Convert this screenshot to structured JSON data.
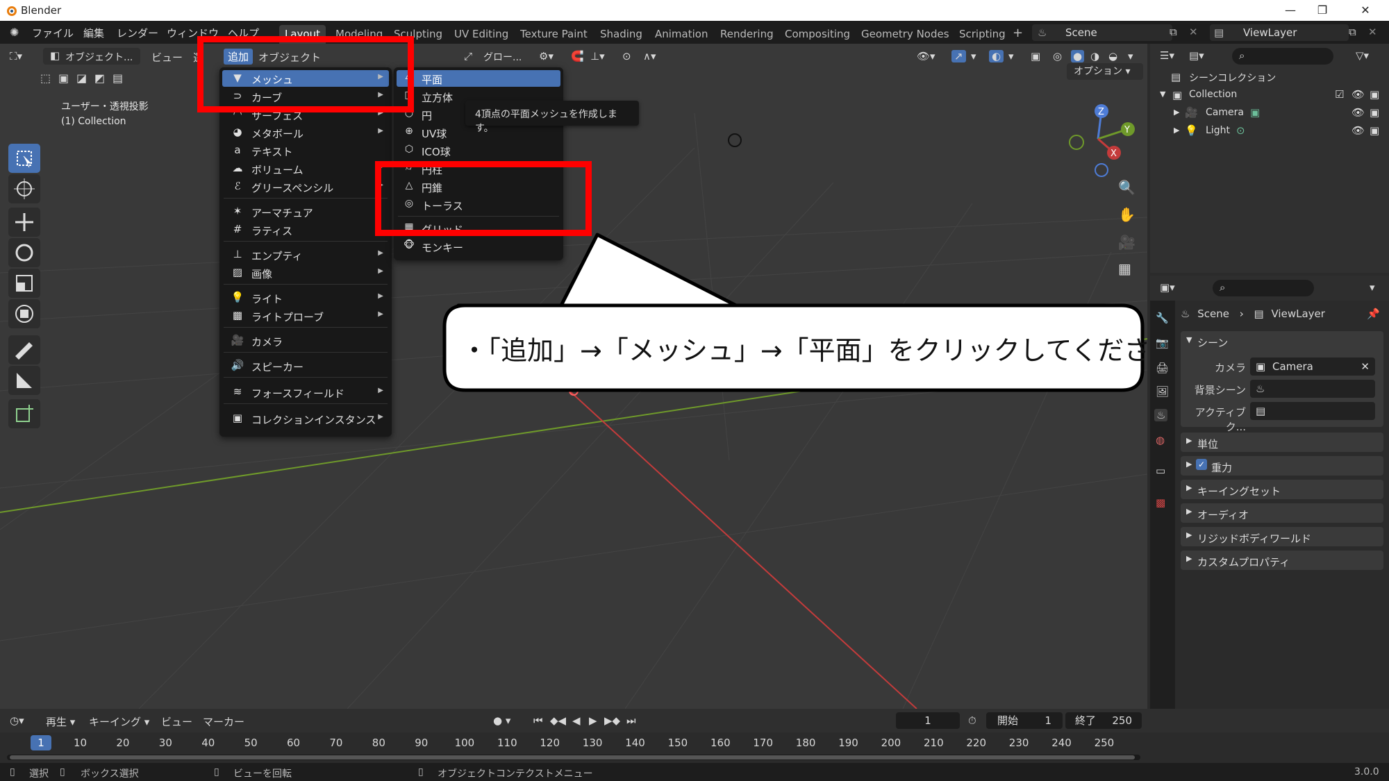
{
  "window": {
    "title": "Blender"
  },
  "menubar": {
    "items": [
      "ファイル",
      "編集",
      "レンダー",
      "ウィンドウ",
      "ヘルプ"
    ],
    "workspaces": [
      "Layout",
      "Modeling",
      "Sculpting",
      "UV Editing",
      "Texture Paint",
      "Shading",
      "Animation",
      "Rendering",
      "Compositing",
      "Geometry Nodes",
      "Scripting"
    ],
    "active_workspace": "Layout",
    "scene": "Scene",
    "view_layer": "ViewLayer"
  },
  "viewport_header": {
    "mode": "オブジェクト...",
    "menus": [
      "ビュー",
      "選",
      "追加",
      "オブジェクト"
    ],
    "transform_orientation": "グロー...",
    "options": "オプション"
  },
  "viewport": {
    "view_name": "ユーザー・透視投影",
    "collection_info": "(1) Collection"
  },
  "add_menu": {
    "items": [
      {
        "label": "メッシュ",
        "icon": "mesh-icon",
        "submenu": true,
        "active": true
      },
      {
        "label": "カーブ",
        "icon": "curve-icon",
        "submenu": true
      },
      {
        "label": "サーフェス",
        "icon": "surface-icon",
        "submenu": true
      },
      {
        "label": "メタボール",
        "icon": "metaball-icon",
        "submenu": true
      },
      {
        "label": "テキスト",
        "icon": "text-icon",
        "submenu": false
      },
      {
        "label": "ボリューム",
        "icon": "volume-icon",
        "submenu": true
      },
      {
        "label": "グリースペンシル",
        "icon": "grease-pencil-icon",
        "submenu": true
      },
      {
        "label": "アーマチュア",
        "icon": "armature-icon",
        "submenu": false
      },
      {
        "label": "ラティス",
        "icon": "lattice-icon",
        "submenu": false
      },
      {
        "label": "エンプティ",
        "icon": "empty-icon",
        "submenu": true
      },
      {
        "label": "画像",
        "icon": "image-icon",
        "submenu": true
      },
      {
        "label": "ライト",
        "icon": "light-icon",
        "submenu": true
      },
      {
        "label": "ライトプローブ",
        "icon": "light-probe-icon",
        "submenu": true
      },
      {
        "label": "カメラ",
        "icon": "camera-icon",
        "submenu": false
      },
      {
        "label": "スピーカー",
        "icon": "speaker-icon",
        "submenu": false
      },
      {
        "label": "フォースフィールド",
        "icon": "force-field-icon",
        "submenu": true
      },
      {
        "label": "コレクションインスタンス",
        "icon": "collection-instance-icon",
        "submenu": true
      }
    ]
  },
  "mesh_menu": {
    "items": [
      {
        "label": "平面",
        "icon": "plane-icon",
        "active": true
      },
      {
        "label": "立方体",
        "icon": "cube-icon"
      },
      {
        "label": "円",
        "icon": "circle-icon"
      },
      {
        "label": "UV球",
        "icon": "uv-sphere-icon"
      },
      {
        "label": "ICO球",
        "icon": "ico-sphere-icon"
      },
      {
        "label": "円柱",
        "icon": "cylinder-icon"
      },
      {
        "label": "円錐",
        "icon": "cone-icon"
      },
      {
        "label": "トーラス",
        "icon": "torus-icon"
      },
      {
        "label": "グリッド",
        "icon": "grid-icon"
      },
      {
        "label": "モンキー",
        "icon": "monkey-icon"
      }
    ],
    "tooltip": "4頂点の平面メッシュを作成します。"
  },
  "callout": {
    "text": "・「追加」→「メッシュ」→「平面」をクリックしてください"
  },
  "outliner": {
    "root": "シーンコレクション",
    "collection": "Collection",
    "objects": [
      "Camera",
      "Light"
    ]
  },
  "properties": {
    "breadcrumb_scene": "Scene",
    "breadcrumb_layer": "ViewLayer",
    "section_scene": "シーン",
    "camera_label": "カメラ",
    "camera_value": "Camera",
    "background_label": "背景シーン",
    "active_clip_label": "アクティブク...",
    "panels": [
      "単位",
      "重力",
      "キーイングセット",
      "オーディオ",
      "リジッドボディワールド",
      "カスタムプロパティ"
    ]
  },
  "timeline": {
    "menus": [
      "再生",
      "キーイング",
      "ビュー",
      "マーカー"
    ],
    "current_frame": "1",
    "start_label": "開始",
    "start_value": "1",
    "end_label": "終了",
    "end_value": "250",
    "ticks": [
      "1",
      "10",
      "20",
      "30",
      "40",
      "50",
      "60",
      "70",
      "80",
      "90",
      "100",
      "110",
      "120",
      "130",
      "140",
      "150",
      "160",
      "170",
      "180",
      "190",
      "200",
      "210",
      "220",
      "230",
      "240",
      "250"
    ]
  },
  "statusbar": {
    "items": [
      "選択",
      "ボックス選択",
      "ビューを回転",
      "オブジェクトコンテクストメニュー"
    ],
    "version": "3.0.0"
  },
  "colors": {
    "accent": "#4772b3",
    "highlight_box": "#ff0000",
    "x_axis": "#c43b3b",
    "y_axis": "#6f9a2a"
  }
}
